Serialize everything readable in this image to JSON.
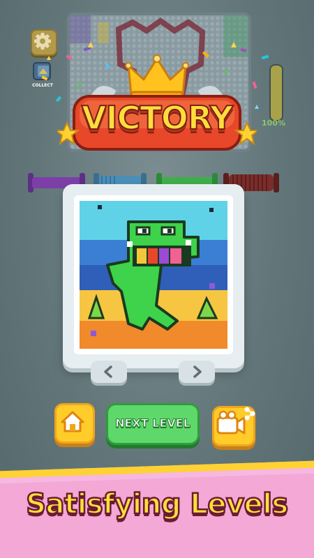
{
  "banner": {
    "title": "VICTORY"
  },
  "board": {
    "progress_text": "100%",
    "progress": 1.0
  },
  "hud": {
    "collect_label": "COLLECT"
  },
  "buttons": {
    "next_label": "NEXT LEVEL"
  },
  "promo": {
    "headline": "Satisfying Levels"
  },
  "colors": {
    "accent_yellow": "#ffcc2a",
    "next_green": "#5ed86a",
    "promo_pink": "#f3a8d6",
    "victory_red": "#e8472a"
  },
  "icons": {
    "settings": "gear-icon",
    "collect": "collection-icon",
    "home": "home-icon",
    "share": "video-share-icon",
    "prev": "chevron-left-icon",
    "next": "chevron-right-icon",
    "crown": "crown-icon",
    "star": "star-icon"
  },
  "spool_colors": [
    "#7c3fa8",
    "#4a8fb8",
    "#3fae4a",
    "#7a2d2a"
  ]
}
